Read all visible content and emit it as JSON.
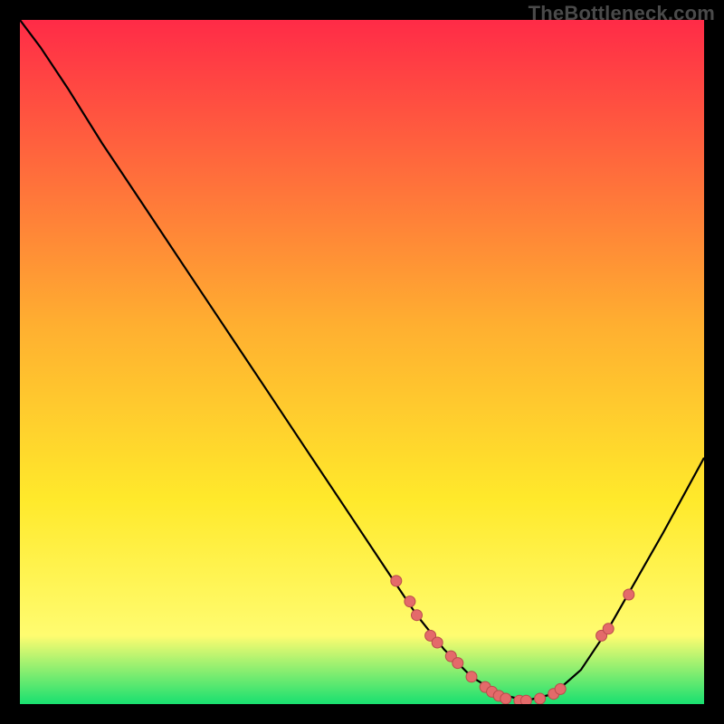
{
  "watermark": "TheBottleneck.com",
  "colors": {
    "page_bg": "#000000",
    "curve": "#000000",
    "dot_fill": "#e46a6a",
    "dot_stroke": "#b94b4b",
    "gradient_stops": [
      {
        "offset": "0%",
        "color": "#ff2b47"
      },
      {
        "offset": "45%",
        "color": "#ffb030"
      },
      {
        "offset": "70%",
        "color": "#ffe92b"
      },
      {
        "offset": "90%",
        "color": "#fffc70"
      },
      {
        "offset": "100%",
        "color": "#18e070"
      }
    ]
  },
  "chart_data": {
    "type": "line",
    "title": "",
    "xlabel": "",
    "ylabel": "",
    "xlim": [
      0,
      100
    ],
    "ylim": [
      0,
      100
    ],
    "grid": false,
    "legend": false,
    "series": [
      {
        "name": "bottleneck-curve",
        "x": [
          0,
          3,
          7,
          12,
          18,
          24,
          30,
          36,
          42,
          48,
          54,
          58,
          62,
          66,
          70,
          74,
          78,
          82,
          86,
          90,
          94,
          100
        ],
        "y": [
          100,
          96,
          90,
          82,
          73,
          64,
          55,
          46,
          37,
          28,
          19,
          13,
          8,
          4,
          1.5,
          0.5,
          1.5,
          5,
          11,
          18,
          25,
          36
        ]
      }
    ],
    "highlight_points": [
      {
        "x": 55,
        "y": 18
      },
      {
        "x": 57,
        "y": 15
      },
      {
        "x": 58,
        "y": 13
      },
      {
        "x": 60,
        "y": 10
      },
      {
        "x": 61,
        "y": 9
      },
      {
        "x": 63,
        "y": 7
      },
      {
        "x": 64,
        "y": 6
      },
      {
        "x": 66,
        "y": 4
      },
      {
        "x": 68,
        "y": 2.5
      },
      {
        "x": 69,
        "y": 1.8
      },
      {
        "x": 70,
        "y": 1.2
      },
      {
        "x": 71,
        "y": 0.8
      },
      {
        "x": 73,
        "y": 0.5
      },
      {
        "x": 74,
        "y": 0.5
      },
      {
        "x": 76,
        "y": 0.8
      },
      {
        "x": 78,
        "y": 1.5
      },
      {
        "x": 79,
        "y": 2.2
      },
      {
        "x": 85,
        "y": 10
      },
      {
        "x": 86,
        "y": 11
      },
      {
        "x": 89,
        "y": 16
      }
    ]
  }
}
